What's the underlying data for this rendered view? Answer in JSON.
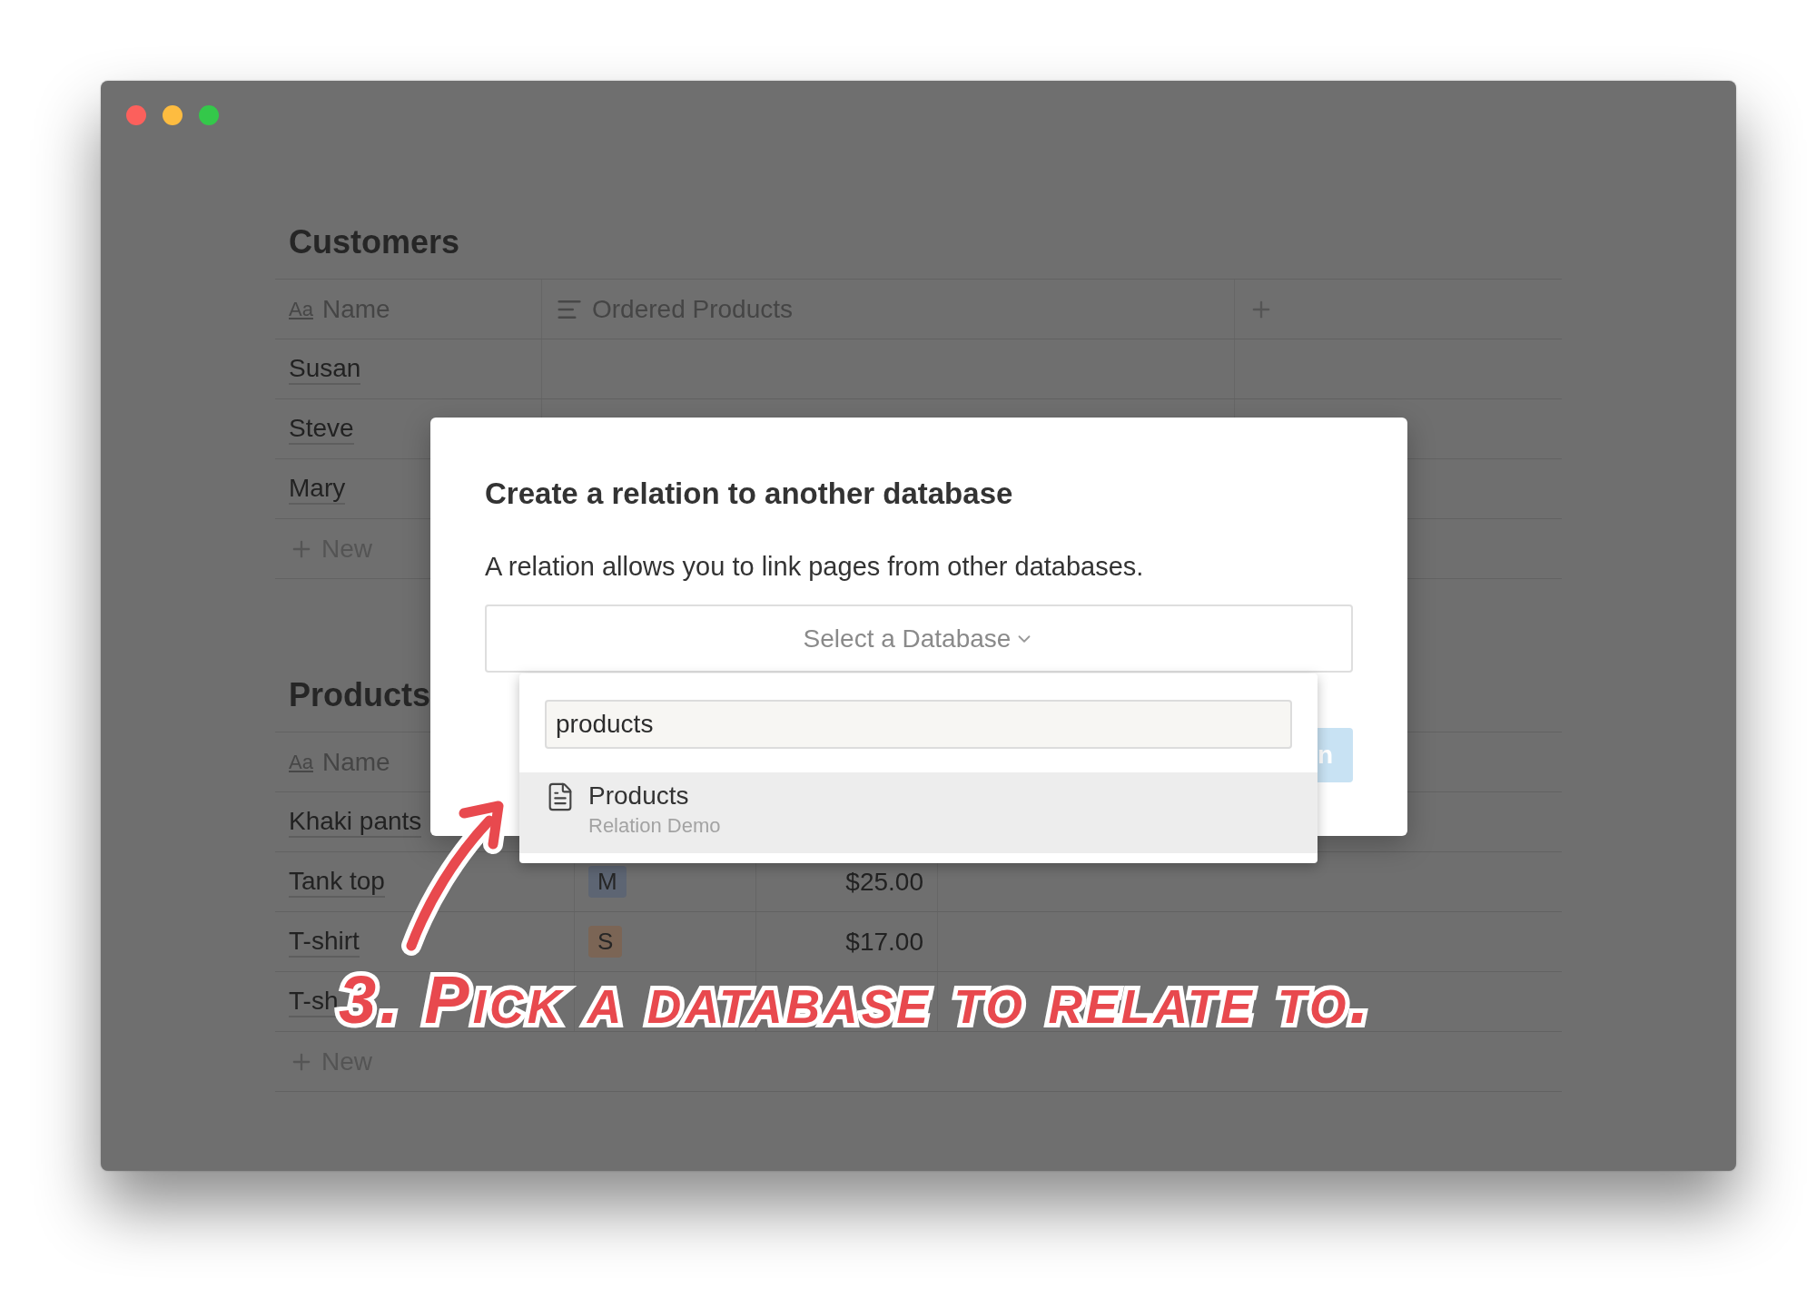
{
  "window": {
    "controls": [
      {
        "color": "#fc605c"
      },
      {
        "color": "#fdbc40"
      },
      {
        "color": "#34c84a"
      }
    ]
  },
  "customers": {
    "title": "Customers",
    "columns": [
      {
        "kind": "title",
        "glyph": "Aa",
        "label": "Name"
      },
      {
        "kind": "text",
        "label": "Ordered Products"
      },
      {
        "kind": "add"
      }
    ],
    "rows": [
      {
        "name": "Susan"
      },
      {
        "name": "Steve"
      },
      {
        "name": "Mary"
      }
    ],
    "new_row": "New"
  },
  "products": {
    "title": "Products",
    "columns": [
      {
        "kind": "title",
        "glyph": "Aa",
        "label": "Name"
      }
    ],
    "rows": [
      {
        "name": "Khaki pants"
      },
      {
        "name": "Tank top",
        "size": {
          "label": "M",
          "color": "#5d6573"
        },
        "price": "$25.00"
      },
      {
        "name": "T-shirt",
        "size": {
          "label": "S",
          "color": "#7b6555"
        },
        "price": "$17.00"
      },
      {
        "name": "T-sh"
      }
    ],
    "new_row": "New"
  },
  "dialog": {
    "title": "Create a relation to another database",
    "description": "A relation allows you to link pages from other databases.",
    "select": {
      "label": "Select a Database"
    },
    "button": {
      "label": "n"
    }
  },
  "dropdown": {
    "search": {
      "value": "products"
    },
    "results": [
      {
        "title": "Products",
        "subtitle": "Relation Demo",
        "selected": true
      }
    ]
  },
  "annotation": {
    "text": "3. Pick a database to relate to."
  }
}
